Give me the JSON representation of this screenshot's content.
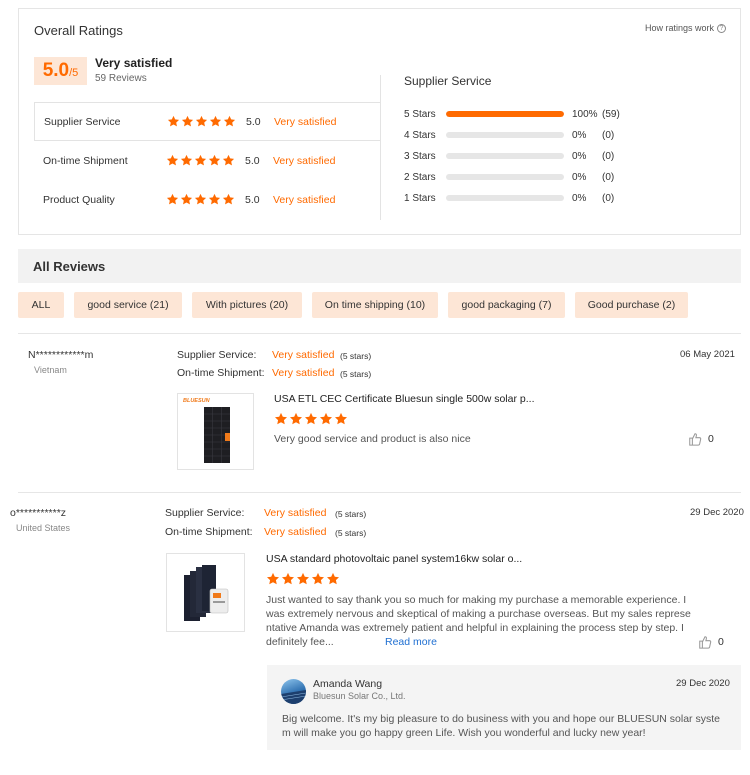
{
  "overall": {
    "title": "Overall Ratings",
    "how_link": "How ratings work",
    "score": "5.0",
    "score_den": "/5",
    "satisfaction": "Very satisfied",
    "reviews_count": "59 Reviews"
  },
  "sub_ratings": [
    {
      "label": "Supplier Service",
      "score": "5.0",
      "text": "Very satisfied",
      "stars": 5
    },
    {
      "label": "On-time Shipment",
      "score": "5.0",
      "text": "Very satisfied",
      "stars": 5
    },
    {
      "label": "Product Quality",
      "score": "5.0",
      "text": "Very satisfied",
      "stars": 5
    }
  ],
  "distribution": {
    "title": "Supplier Service",
    "rows": [
      {
        "label": "5 Stars",
        "pct": "100%",
        "count": "(59)",
        "fill": 1.0
      },
      {
        "label": "4 Stars",
        "pct": "0%",
        "count": "(0)",
        "fill": 0
      },
      {
        "label": "3 Stars",
        "pct": "0%",
        "count": "(0)",
        "fill": 0
      },
      {
        "label": "2 Stars",
        "pct": "0%",
        "count": "(0)",
        "fill": 0
      },
      {
        "label": "1 Stars",
        "pct": "0%",
        "count": "(0)",
        "fill": 0
      }
    ]
  },
  "all_reviews": {
    "title": "All Reviews",
    "filters": [
      "ALL",
      "good service (21)",
      "With pictures (20)",
      "On time shipping (10)",
      "good packaging (7)",
      "Good purchase (2)"
    ]
  },
  "reviews": [
    {
      "user": "N************m",
      "country": "Vietnam",
      "date": "06 May 2021",
      "supplier_label": "Supplier Service:",
      "supplier_value": "Very satisfied",
      "supplier_stars": "(5 stars)",
      "shipment_label": "On-time Shipment:",
      "shipment_value": "Very satisfied",
      "shipment_stars": "(5 stars)",
      "product_title": "USA ETL CEC Certificate Bluesun single 500w solar p...",
      "product_brand": "BLUESUN",
      "rating": 5,
      "comment": "Very good service and product is also nice",
      "likes": "0"
    },
    {
      "user": "o***********z",
      "country": "United States",
      "date": "29 Dec 2020",
      "supplier_label": "Supplier Service:",
      "supplier_value": "Very satisfied",
      "supplier_stars": "(5 stars)",
      "shipment_label": "On-time Shipment:",
      "shipment_value": "Very satisfied",
      "shipment_stars": "(5 stars)",
      "product_title": "USA standard photovoltaic panel system16kw solar o...",
      "rating": 5,
      "comment_lines": [
        "Just wanted to say thank you so much for making my purchase a memorable experience. I",
        "was extremely nervous and skeptical of making a purchase overseas.  But my sales represe",
        "ntative Amanda was extremely patient and helpful in explaining the process step by step.  I",
        "definitely fee..."
      ],
      "read_more": "Read more",
      "likes": "0",
      "reply": {
        "name": "Amanda Wang",
        "company": "Bluesun Solar Co., Ltd.",
        "date": "29 Dec 2020",
        "lines": [
          "Big welcome. It's my big pleasure to do business with you and hope our BLUESUN solar syste",
          "m will make you go happy green Life. Wish you wonderful and lucky new year!"
        ]
      }
    }
  ],
  "colors": {
    "accent": "#ff6a00",
    "chip_bg": "#fde6d6",
    "link": "#1f6fd1"
  }
}
